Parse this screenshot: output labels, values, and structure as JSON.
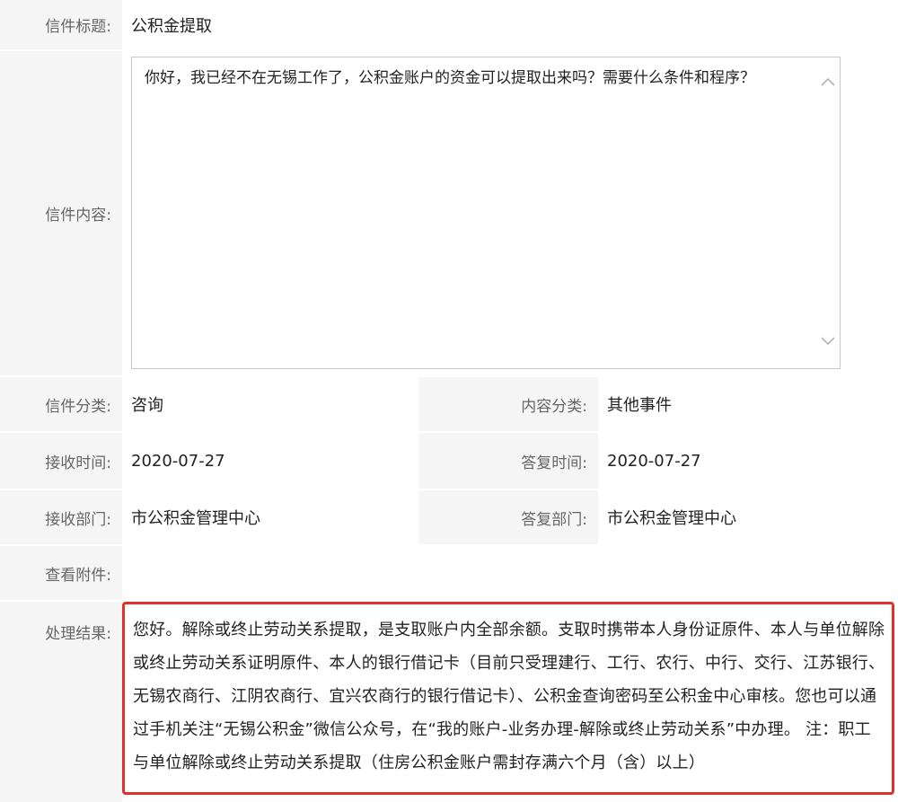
{
  "title": {
    "label": "信件标题:",
    "value": "公积金提取"
  },
  "content": {
    "label": "信件内容:",
    "text": "你好，我已经不在无锡工作了，公积金账户的资金可以提取出来吗？需要什么条件和程序？"
  },
  "category": {
    "label": "信件分类:",
    "value": "咨询"
  },
  "content_category": {
    "label": "内容分类:",
    "value": "其他事件"
  },
  "received_time": {
    "label": "接收时间:",
    "value": "2020-07-27"
  },
  "reply_time": {
    "label": "答复时间:",
    "value": "2020-07-27"
  },
  "received_dept": {
    "label": "接收部门:",
    "value": "市公积金管理中心"
  },
  "reply_dept": {
    "label": "答复部门:",
    "value": "市公积金管理中心"
  },
  "attachments": {
    "label": "查看附件:",
    "value": ""
  },
  "result": {
    "label": "处理结果:",
    "text": "您好。解除或终止劳动关系提取，是支取账户内全部余额。支取时携带本人身份证原件、本人与单位解除或终止劳动关系证明原件、本人的银行借记卡（目前只受理建行、工行、农行、中行、交行、江苏银行、无锡农商行、江阴农商行、宜兴农商行的银行借记卡）、公积金查询密码至公积金中心审核。您也可以通过手机关注“无锡公积金”微信公众号，在“我的账户-业务办理-解除或终止劳动关系”中办理。 注：职工与单位解除或终止劳动关系提取（住房公积金账户需封存满六个月（含）以上）"
  },
  "colors": {
    "label_bg": "#f5f5f5",
    "highlight_border": "#e0312d"
  },
  "icons": {
    "scroll_up": "chevron-up-icon",
    "scroll_down": "chevron-down-icon"
  }
}
